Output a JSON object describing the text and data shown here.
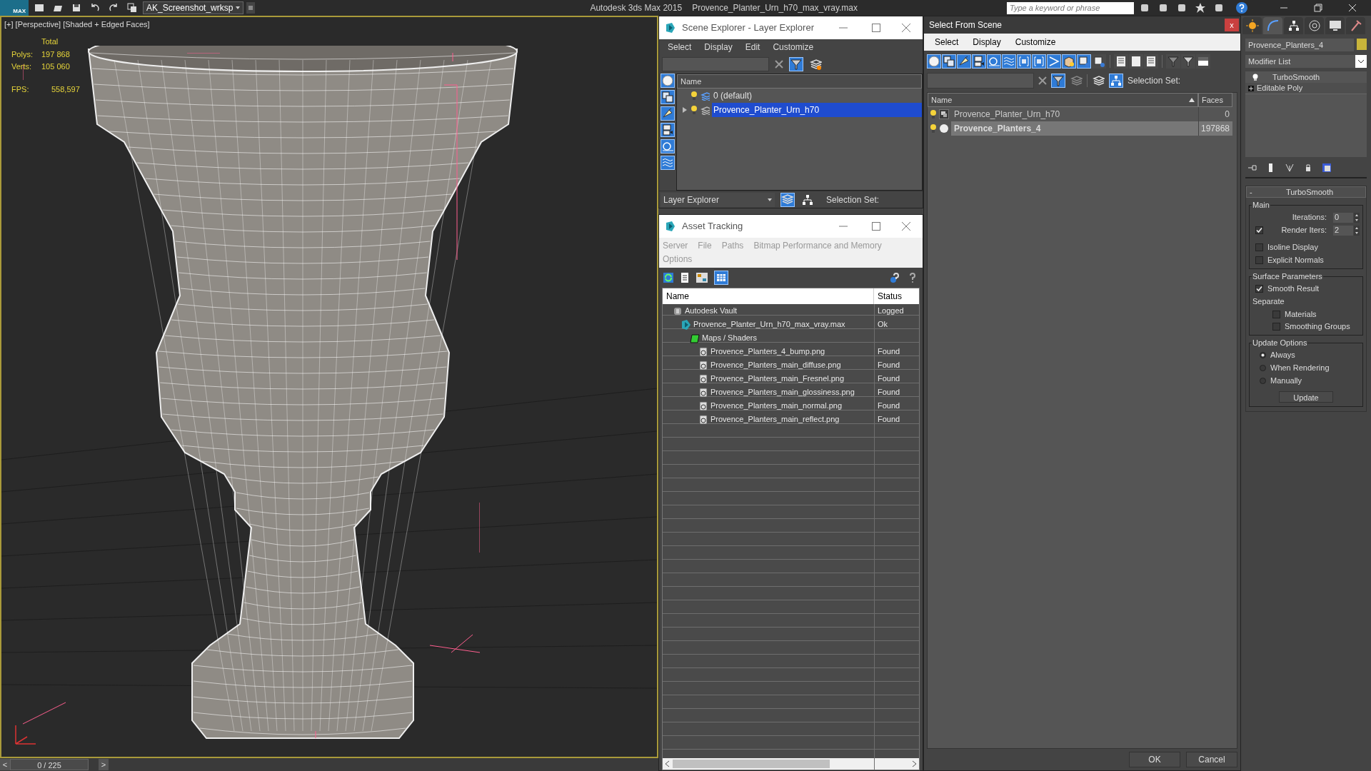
{
  "title_bar": {
    "logo": "MAX",
    "workspace": "AK_Screenshot_wrksp",
    "app": "Autodesk 3ds Max  2015",
    "file": "Provence_Planter_Urn_h70_max_vray.max",
    "search_placeholder": "Type a keyword or phrase"
  },
  "viewport": {
    "label": "[+] [Perspective] [Shaded + Edged Faces]",
    "stats_header": "Total",
    "stats": [
      {
        "label": "Polys:",
        "value": "197 868"
      },
      {
        "label": "Verts:",
        "value": "105 060"
      }
    ],
    "fps_label": "FPS:",
    "fps_value": "558,597"
  },
  "time_slider": {
    "prev": "<",
    "position": "0 / 225",
    "next": ">"
  },
  "scene_explorer": {
    "title": "Scene Explorer - Layer Explorer",
    "menu": [
      "Select",
      "Display",
      "Edit",
      "Customize"
    ],
    "column": "Name",
    "rows": [
      {
        "name": "0 (default)",
        "selected": false,
        "expandable": false
      },
      {
        "name": "Provence_Planter_Urn_h70",
        "selected": true,
        "expandable": true
      }
    ],
    "mode": "Layer Explorer",
    "selection_set_label": "Selection Set:"
  },
  "asset_tracking": {
    "title": "Asset Tracking",
    "menu": [
      "Server",
      "File",
      "Paths",
      "Bitmap Performance and Memory",
      "Options"
    ],
    "columns": [
      "Name",
      "Status"
    ],
    "rows": [
      {
        "kind": "vault",
        "name": "Autodesk Vault",
        "status": "Logged",
        "children": [
          {
            "kind": "max_file",
            "name": "Provence_Planter_Urn_h70_max_vray.max",
            "status": "Ok",
            "children": [
              {
                "kind": "folder",
                "name": "Maps / Shaders",
                "children": [
                  {
                    "kind": "bitmap",
                    "name": "Provence_Planters_4_bump.png",
                    "status": "Found"
                  },
                  {
                    "kind": "bitmap",
                    "name": "Provence_Planters_main_diffuse.png",
                    "status": "Found"
                  },
                  {
                    "kind": "bitmap",
                    "name": "Provence_Planters_main_Fresnel.png",
                    "status": "Found"
                  },
                  {
                    "kind": "bitmap",
                    "name": "Provence_Planters_main_glossiness.png",
                    "status": "Found"
                  },
                  {
                    "kind": "bitmap",
                    "name": "Provence_Planters_main_normal.png",
                    "status": "Found"
                  },
                  {
                    "kind": "bitmap",
                    "name": "Provence_Planters_main_reflect.png",
                    "status": "Found"
                  }
                ]
              }
            ]
          }
        ]
      }
    ]
  },
  "select_from_scene": {
    "title": "Select From Scene",
    "close": "x",
    "menu": [
      "Select",
      "Display",
      "Customize"
    ],
    "selection_set_label": "Selection Set:",
    "columns": [
      "Name",
      "Faces"
    ],
    "rows": [
      {
        "kind": "group",
        "name": "Provence_Planter_Urn_h70",
        "faces": "0",
        "selected": false
      },
      {
        "kind": "geometry",
        "name": "Provence_Planters_4",
        "faces": "197868",
        "selected": true
      }
    ],
    "buttons": [
      "OK",
      "Cancel"
    ]
  },
  "command_panel": {
    "object_name": "Provence_Planters_4",
    "modifier_list": "Modifier List",
    "stack": [
      {
        "kind": "modifier",
        "name": "TurboSmooth"
      },
      {
        "kind": "base",
        "name": "Editable Poly"
      }
    ],
    "rollout": {
      "collapse": "-",
      "title": "TurboSmooth",
      "groups": [
        {
          "title": "Main",
          "items": [
            {
              "kind": "spinner",
              "label": "Iterations:",
              "value": "0"
            },
            {
              "kind": "check_spinner",
              "label": "Render Iters:",
              "value": "2",
              "checked": true
            },
            {
              "kind": "checkbox",
              "label": "Isoline Display",
              "checked": false
            },
            {
              "kind": "checkbox",
              "label": "Explicit Normals",
              "checked": false
            }
          ]
        },
        {
          "title": "Surface Parameters",
          "items": [
            {
              "kind": "checkbox",
              "label": "Smooth Result",
              "checked": true
            },
            {
              "kind": "heading",
              "label": "Separate",
              "children": [
                {
                  "kind": "checkbox",
                  "label": "Materials",
                  "checked": false
                },
                {
                  "kind": "checkbox",
                  "label": "Smoothing Groups",
                  "checked": false
                }
              ]
            }
          ]
        },
        {
          "title": "Update Options",
          "items": [
            {
              "kind": "radio",
              "label": "Always",
              "selected": true
            },
            {
              "kind": "radio",
              "label": "When Rendering",
              "selected": false
            },
            {
              "kind": "radio",
              "label": "Manually",
              "selected": false
            },
            {
              "kind": "button",
              "label": "Update"
            }
          ]
        }
      ]
    }
  }
}
